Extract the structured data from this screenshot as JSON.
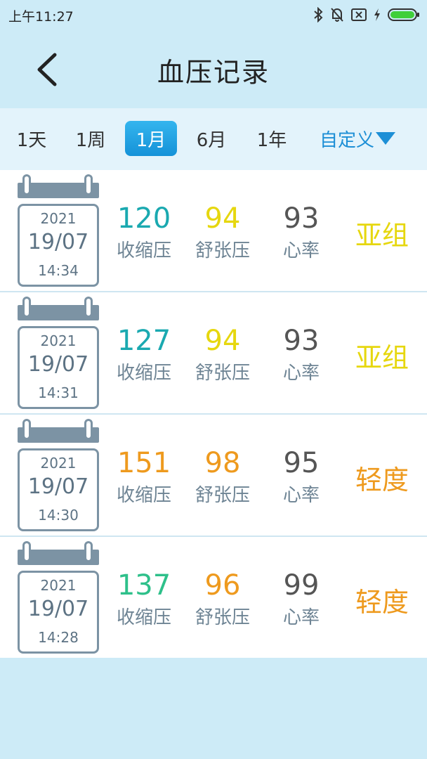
{
  "status_bar": {
    "time": "上午11:27"
  },
  "header": {
    "title": "血压记录"
  },
  "filters": {
    "tabs": [
      "1天",
      "1周",
      "1月",
      "6月",
      "1年"
    ],
    "active_index": 2,
    "custom_label": "自定义"
  },
  "labels": {
    "systolic": "收缩压",
    "diastolic": "舒张压",
    "heart_rate": "心率"
  },
  "colors": {
    "teal": "#1aa9b0",
    "yellow": "#e6d70f",
    "orange": "#ee9a1e",
    "green": "#2ec08a",
    "gray": "#555555"
  },
  "records": [
    {
      "year": "2021",
      "date": "19/07",
      "time": "14:34",
      "systolic": "120",
      "diastolic": "94",
      "heart_rate": "93",
      "level": "亚组",
      "systolic_color": "#1aa9b0",
      "diastolic_color": "#e6d70f",
      "level_color": "#e6d70f"
    },
    {
      "year": "2021",
      "date": "19/07",
      "time": "14:31",
      "systolic": "127",
      "diastolic": "94",
      "heart_rate": "93",
      "level": "亚组",
      "systolic_color": "#1aa9b0",
      "diastolic_color": "#e6d70f",
      "level_color": "#e6d70f"
    },
    {
      "year": "2021",
      "date": "19/07",
      "time": "14:30",
      "systolic": "151",
      "diastolic": "98",
      "heart_rate": "95",
      "level": "轻度",
      "systolic_color": "#ee9a1e",
      "diastolic_color": "#ee9a1e",
      "level_color": "#ee9a1e"
    },
    {
      "year": "2021",
      "date": "19/07",
      "time": "14:28",
      "systolic": "137",
      "diastolic": "96",
      "heart_rate": "99",
      "level": "轻度",
      "systolic_color": "#2ec08a",
      "diastolic_color": "#ee9a1e",
      "level_color": "#ee9a1e"
    }
  ],
  "icons": [
    "bluetooth-icon",
    "mute-bell-icon",
    "sim-x-icon",
    "charging-icon",
    "battery-icon",
    "back-chevron-icon",
    "calendar-icon",
    "dropdown-triangle-icon"
  ]
}
